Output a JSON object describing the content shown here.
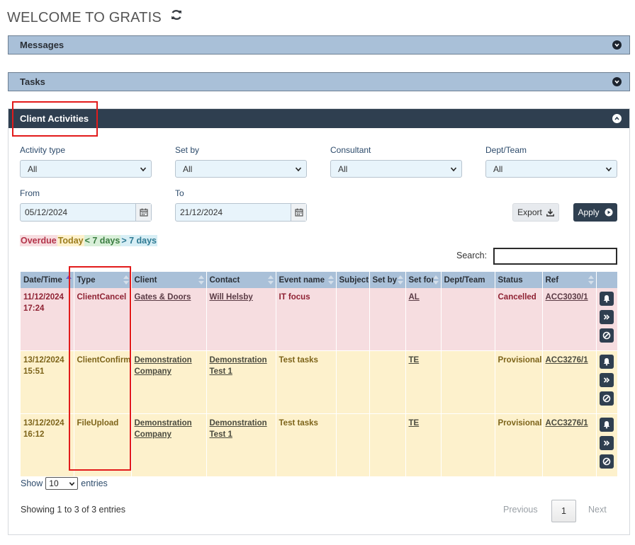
{
  "page": {
    "title": "WELCOME TO GRATIS"
  },
  "panels": {
    "messages": "Messages",
    "tasks": "Tasks",
    "client_activities": "Client Activities"
  },
  "filters": {
    "activity_type": {
      "label": "Activity type",
      "value": "All"
    },
    "set_by": {
      "label": "Set by",
      "value": "All"
    },
    "consultant": {
      "label": "Consultant",
      "value": "All"
    },
    "dept_team": {
      "label": "Dept/Team",
      "value": "All"
    },
    "from": {
      "label": "From",
      "value": "05/12/2024"
    },
    "to": {
      "label": "To",
      "value": "21/12/2024"
    }
  },
  "buttons": {
    "export": "Export",
    "apply": "Apply"
  },
  "legend": {
    "overdue": "Overdue",
    "today": "Today",
    "lt7": "< 7 days",
    "gt7": "> 7 days"
  },
  "search": {
    "label": "Search:",
    "value": ""
  },
  "table": {
    "columns": [
      "Date/Time",
      "Type",
      "Client",
      "Contact",
      "Event name",
      "Subject",
      "Set by",
      "Set for",
      "Dept/Team",
      "Status",
      "Ref"
    ],
    "rows": [
      {
        "date": "11/12/2024",
        "time": "17:24",
        "type": "ClientCancel",
        "client": "Gates & Doors",
        "client2": "",
        "contact": "Will Helsby",
        "contact2": "",
        "event": "IT focus",
        "subject": "",
        "set_by": "",
        "set_for": "AL",
        "dept": "",
        "status": "Cancelled",
        "ref": "ACC3030/1"
      },
      {
        "date": "13/12/2024",
        "time": "15:51",
        "type": "ClientConfirm",
        "client": "Demonstration",
        "client2": "Company",
        "contact": "Demonstration",
        "contact2": "Test 1",
        "event": "Test tasks",
        "subject": "",
        "set_by": "",
        "set_for": "TE",
        "dept": "",
        "status": "Provisional",
        "ref": "ACC3276/1"
      },
      {
        "date": "13/12/2024",
        "time": "16:12",
        "type": "FileUpload",
        "client": "Demonstration",
        "client2": "Company",
        "contact": "Demonstration",
        "contact2": "Test 1",
        "event": "Test tasks",
        "subject": "",
        "set_by": "",
        "set_for": "TE",
        "dept": "",
        "status": "Provisional",
        "ref": "ACC3276/1"
      }
    ]
  },
  "length": {
    "show": "Show",
    "value": "10",
    "entries": "entries"
  },
  "info": "Showing 1 to 3 of 3 entries",
  "pager": {
    "previous": "Previous",
    "page": "1",
    "next": "Next"
  },
  "colors": {
    "header_dark": "#2f3f50",
    "header_light": "#a9c0d8",
    "overdue_bg": "#f6dde0",
    "today_bg": "#fdf1cc",
    "highlight": "#e21b1b"
  },
  "icons": {
    "refresh": "refresh-icon",
    "chevron": "chevron-down-icon",
    "calendar": "calendar-icon",
    "download": "download-icon",
    "play": "play-circle-icon",
    "bell": "bell-icon",
    "forward": "double-chevron-right-icon",
    "cancel": "ban-icon"
  }
}
